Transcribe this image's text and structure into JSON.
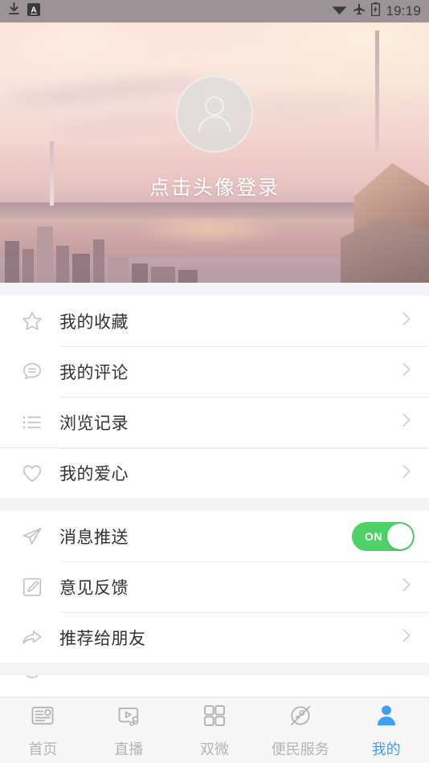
{
  "statusbar": {
    "icons": [
      "download-icon",
      "input-method-badge-icon",
      "wifi-icon",
      "airplane-mode-icon",
      "battery-charging-icon"
    ],
    "badge_letter": "A",
    "time": "19:19"
  },
  "hero": {
    "avatar_icon": "person-avatar-icon",
    "login_prompt": "点击头像登录"
  },
  "menu_groups": [
    {
      "items": [
        {
          "icon": "star-icon",
          "label": "我的收藏",
          "accessory": "chevron-right-icon"
        },
        {
          "icon": "comment-icon",
          "label": "我的评论",
          "accessory": "chevron-right-icon"
        },
        {
          "icon": "list-icon",
          "label": "浏览记录",
          "accessory": "chevron-right-icon"
        },
        {
          "icon": "heart-icon",
          "label": "我的爱心",
          "accessory": "chevron-right-icon"
        }
      ]
    },
    {
      "items": [
        {
          "icon": "paper-plane-icon",
          "label": "消息推送",
          "accessory": "toggle",
          "toggle_state": "ON"
        },
        {
          "icon": "pencil-square-icon",
          "label": "意见反馈",
          "accessory": "chevron-right-icon"
        },
        {
          "icon": "share-arrow-icon",
          "label": "推荐给朋友",
          "accessory": "chevron-right-icon"
        }
      ]
    }
  ],
  "tabbar": {
    "tabs": [
      {
        "icon": "newspaper-icon",
        "label": "首页",
        "active": false
      },
      {
        "icon": "video-music-icon",
        "label": "直播",
        "active": false
      },
      {
        "icon": "grid-icon",
        "label": "双微",
        "active": false
      },
      {
        "icon": "planet-icon",
        "label": "便民服务",
        "active": false
      },
      {
        "icon": "person-icon",
        "label": "我的",
        "active": true
      }
    ],
    "active_color": "#3d9ff5",
    "inactive_color": "#b4b4b4"
  },
  "colors": {
    "toggle_on": "#4ed265",
    "page_bg": "#f4f4f6",
    "card_bg": "#ffffff",
    "text": "#333333",
    "icon_gray": "#bcbcbc"
  }
}
